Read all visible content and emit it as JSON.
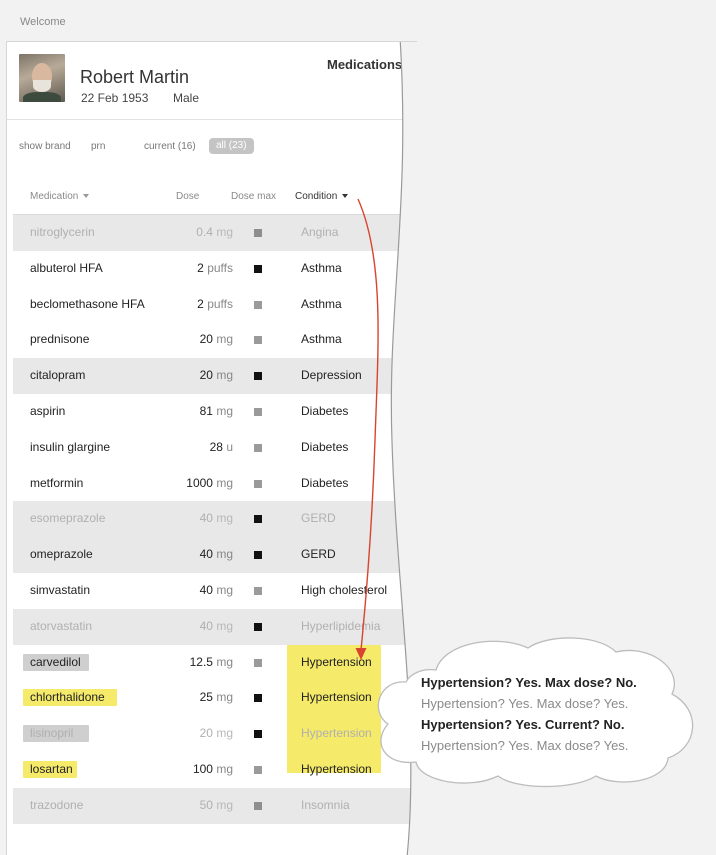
{
  "breadcrumb": "Welcome",
  "patient": {
    "name": "Robert Martin",
    "dob": "22 Feb 1953",
    "sex": "Male"
  },
  "section_title": "Medications",
  "filters": {
    "show_brand": "show brand",
    "prn": "prn",
    "current": "current (16)",
    "all": "all (23)"
  },
  "columns": {
    "medication": "Medication",
    "dose": "Dose",
    "dose_max": "Dose max",
    "condition": "Condition"
  },
  "rows": [
    {
      "name": "nitroglycerin",
      "dose": "0.4",
      "unit": "mg",
      "max": "gray",
      "condition": "Angina",
      "state": "faded-shaded"
    },
    {
      "name": "albuterol HFA",
      "dose": "2",
      "unit": "puffs",
      "max": "black",
      "condition": "Asthma",
      "state": "normal"
    },
    {
      "name": "beclomethasone HFA",
      "dose": "2",
      "unit": "puffs",
      "max": "gray",
      "condition": "Asthma",
      "state": "normal"
    },
    {
      "name": "prednisone",
      "dose": "20",
      "unit": "mg",
      "max": "gray",
      "condition": "Asthma",
      "state": "normal"
    },
    {
      "name": "citalopram",
      "dose": "20",
      "unit": "mg",
      "max": "black",
      "condition": "Depression",
      "state": "shaded"
    },
    {
      "name": "aspirin",
      "dose": "81",
      "unit": "mg",
      "max": "gray",
      "condition": "Diabetes",
      "state": "normal"
    },
    {
      "name": "insulin glargine",
      "dose": "28",
      "unit": "u",
      "max": "gray",
      "condition": "Diabetes",
      "state": "normal"
    },
    {
      "name": "metformin",
      "dose": "1000",
      "unit": "mg",
      "max": "gray",
      "condition": "Diabetes",
      "state": "normal"
    },
    {
      "name": "esomeprazole",
      "dose": "40",
      "unit": "mg",
      "max": "black",
      "condition": "GERD",
      "state": "faded-shaded"
    },
    {
      "name": "omeprazole",
      "dose": "40",
      "unit": "mg",
      "max": "black",
      "condition": "GERD",
      "state": "shaded"
    },
    {
      "name": "simvastatin",
      "dose": "40",
      "unit": "mg",
      "max": "gray",
      "condition": "High cholesterol",
      "state": "normal"
    },
    {
      "name": "atorvastatin",
      "dose": "40",
      "unit": "mg",
      "max": "black",
      "condition": "Hyperlipidemia",
      "state": "faded-shaded"
    },
    {
      "name": "carvedilol",
      "dose": "12.5",
      "unit": "mg",
      "max": "gray",
      "condition": "Hypertension",
      "state": "normal",
      "mark": "gray"
    },
    {
      "name": "chlorthalidone",
      "dose": "25",
      "unit": "mg",
      "max": "black",
      "condition": "Hypertension",
      "state": "normal",
      "mark": "yellow"
    },
    {
      "name": "lisinopril",
      "dose": "20",
      "unit": "mg",
      "max": "black",
      "condition": "Hypertension",
      "state": "faded",
      "mark": "gray"
    },
    {
      "name": "losartan",
      "dose": "100",
      "unit": "mg",
      "max": "gray",
      "condition": "Hypertension",
      "state": "normal",
      "mark": "yellow"
    },
    {
      "name": "trazodone",
      "dose": "50",
      "unit": "mg",
      "max": "gray",
      "condition": "Insomnia",
      "state": "faded-shaded"
    }
  ],
  "callout": [
    {
      "text": "Hypertension? Yes. Max dose? No.",
      "weight": "strong"
    },
    {
      "text": "Hypertension? Yes. Max dose? Yes.",
      "weight": "light"
    },
    {
      "text": "Hypertension? Yes. Current? No.",
      "weight": "strong"
    },
    {
      "text": "Hypertension? Yes. Max dose? Yes.",
      "weight": "light"
    }
  ],
  "colors": {
    "highlight": "#f5ea6a",
    "annotation_arrow": "#d9442e",
    "row_shade": "#e8e8e8",
    "pill": "#c4c4c4"
  }
}
